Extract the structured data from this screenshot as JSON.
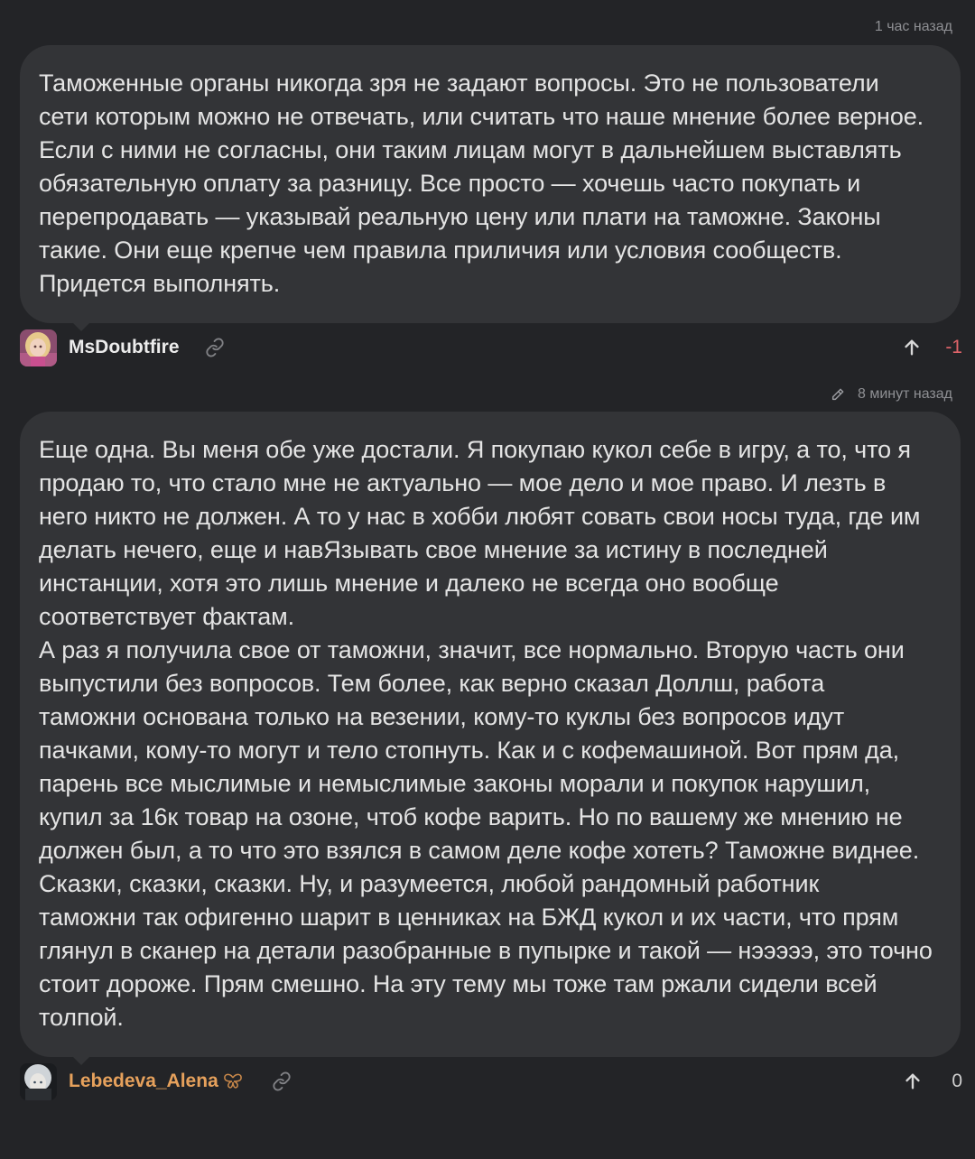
{
  "comments": [
    {
      "timestamp": "1 час назад",
      "text": "Таможенные органы никогда зря не задают вопросы. Это не пользователи\nсети которым можно не отвечать, или считать что наше мнение более верное.\nЕсли с ними не согласны, они таким лицам могут в дальнейшем выставлять\nобязательную оплату за разницу. Все просто — хочешь часто покупать и\nперепродавать — указывай реальную цену или плати на таможне. Законы\nтакие. Они еще крепче чем правила приличия или условия сообществ.\nПридется выполнять.",
      "author": "MsDoubtfire",
      "author_color": "#ececec",
      "score": "-1",
      "score_color": "#e0646a"
    },
    {
      "timestamp": "8 минут назад",
      "edited": true,
      "text": "Еще одна. Вы меня обе уже достали. Я покупаю кукол себе в игру, а то, что я\nпродаю то, что стало мне не актуально — мое дело и мое право. И лезть в\nнего никто не должен. А то у нас в хобби любят совать свои носы туда, где им\nделать нечего, еще и навЯзывать свое мнение за истину в последней\nинстанции, хотя это лишь мнение и далеко не всегда оно вообще\nсоответствует фактам.\nА раз я получила свое от таможни, значит, все нормально. Вторую часть они\nвыпустили без вопросов. Тем более, как верно сказал Доллш, работа\nтаможни основана только на везении, кому-то куклы без вопросов идут\nпачками, кому-то могут и тело стопнуть. Как и с кофемашиной. Вот прям да,\nпарень все мыслимые и немыслимые законы морали и покупок нарушил,\nкупил за 16к товар на озоне, чтоб кофе варить. Но по вашему же мнению не\nдолжен был, а то что это взялся в самом деле кофе хотеть? Таможне виднее.\nСказки, сказки, сказки. Ну, и разумеется, любой рандомный работник\nтаможни так офигенно шарит в ценниках на БЖД кукол и их части, что прям\nглянул в сканер на детали разобранные в пупырке и такой — нэээээ, это точно\nстоит дороже. Прям смешно. На эту тему мы тоже там ржали сидели всей\nтолпой.",
      "author": "Lebedeva_Alena",
      "author_color": "#e6a15c",
      "author_badge": "butterfly-icon",
      "score": "0",
      "score_color": "#cfcfcf"
    }
  ],
  "colors": {
    "background": "#232427",
    "bubble": "#333437",
    "meta_text": "#8e8f93"
  }
}
